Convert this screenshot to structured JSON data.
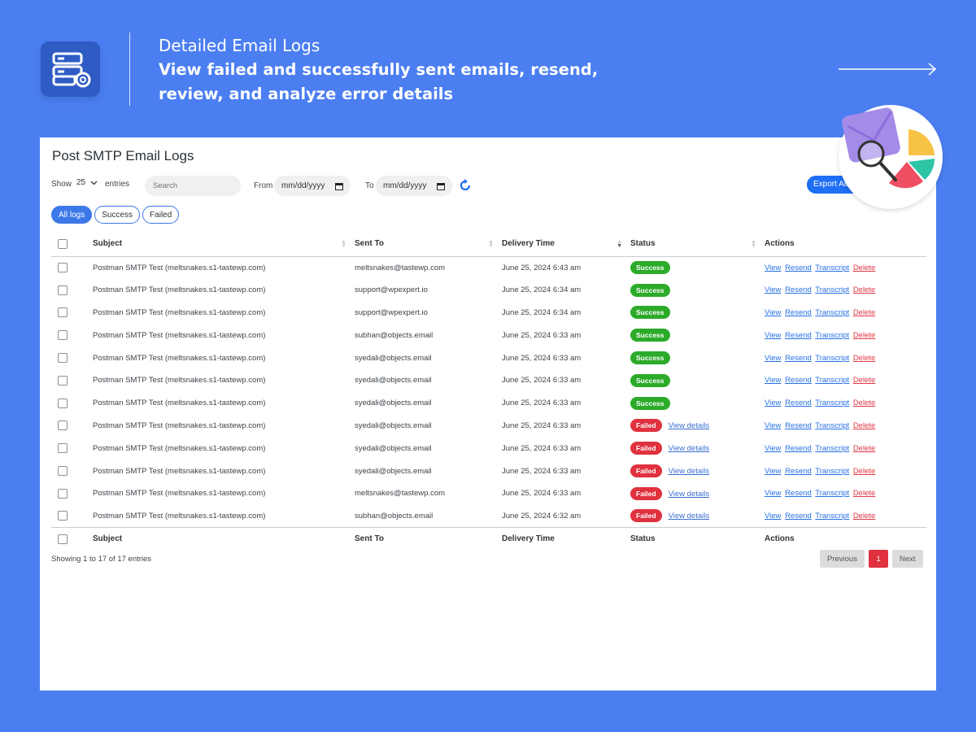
{
  "header": {
    "title": "Detailed Email Logs",
    "subtitle": "View failed and successfully sent emails, resend, review, and analyze error details",
    "logo_icon": "server-email-icon",
    "arrow_icon": "long-arrow-right-icon"
  },
  "panel": {
    "title": "Post SMTP Email Logs",
    "show_label": "Show",
    "show_value": "25",
    "entries_label": "entries",
    "search_placeholder": "Search",
    "from_label": "From",
    "from_value": "mm/dd/yyyy",
    "to_label": "To",
    "to_value": "mm/dd/yyyy",
    "export_label": "Export All",
    "filters": [
      "All logs",
      "Success",
      "Failed"
    ],
    "columns": [
      "Subject",
      "Sent To",
      "Delivery Time",
      "Status",
      "Actions"
    ],
    "actions": [
      "View",
      "Resend",
      "Transcript",
      "Delete"
    ],
    "view_details": "View details",
    "rows": [
      {
        "subject": "Postman SMTP Test (meltsnakes.s1-tastewp.com)",
        "to": "meltsnakes@tastewp.com",
        "time": "June 25, 2024 6:43 am",
        "status": "Success"
      },
      {
        "subject": "Postman SMTP Test (meltsnakes.s1-tastewp.com)",
        "to": "support@wpexpert.io",
        "time": "June 25, 2024 6:34 am",
        "status": "Success"
      },
      {
        "subject": "Postman SMTP Test (meltsnakes.s1-tastewp.com)",
        "to": "support@wpexpert.io",
        "time": "June 25, 2024 6:34 am",
        "status": "Success"
      },
      {
        "subject": "Postman SMTP Test (meltsnakes.s1-tastewp.com)",
        "to": "subhan@objects.email",
        "time": "June 25, 2024 6:33 am",
        "status": "Success"
      },
      {
        "subject": "Postman SMTP Test (meltsnakes.s1-tastewp.com)",
        "to": "syedali@objects.email",
        "time": "June 25, 2024 6:33 am",
        "status": "Success"
      },
      {
        "subject": "Postman SMTP Test (meltsnakes.s1-tastewp.com)",
        "to": "syedali@objects.email",
        "time": "June 25, 2024 6:33 am",
        "status": "Success"
      },
      {
        "subject": "Postman SMTP Test (meltsnakes.s1-tastewp.com)",
        "to": "syedali@objects.email",
        "time": "June 25, 2024 6:33 am",
        "status": "Success"
      },
      {
        "subject": "Postman SMTP Test (meltsnakes.s1-tastewp.com)",
        "to": "syedali@objects.email",
        "time": "June 25, 2024 6:33 am",
        "status": "Failed"
      },
      {
        "subject": "Postman SMTP Test (meltsnakes.s1-tastewp.com)",
        "to": "syedali@objects.email",
        "time": "June 25, 2024 6:33 am",
        "status": "Failed"
      },
      {
        "subject": "Postman SMTP Test (meltsnakes.s1-tastewp.com)",
        "to": "syedali@objects.email",
        "time": "June 25, 2024 6:33 am",
        "status": "Failed"
      },
      {
        "subject": "Postman SMTP Test (meltsnakes.s1-tastewp.com)",
        "to": "meltsnakes@tastewp.com",
        "time": "June 25, 2024 6:33 am",
        "status": "Failed"
      },
      {
        "subject": "Postman SMTP Test (meltsnakes.s1-tastewp.com)",
        "to": "subhan@objects.email",
        "time": "June 25, 2024 6:32 am",
        "status": "Failed"
      }
    ],
    "showing_text": "Showing 1 to 17 of 17 entries",
    "pagination": {
      "previous": "Previous",
      "page": "1",
      "next": "Next"
    }
  },
  "colors": {
    "background": "#4b7ef1",
    "success": "#2cab2a",
    "failed": "#e0313f",
    "accent": "#1f6ff4"
  }
}
